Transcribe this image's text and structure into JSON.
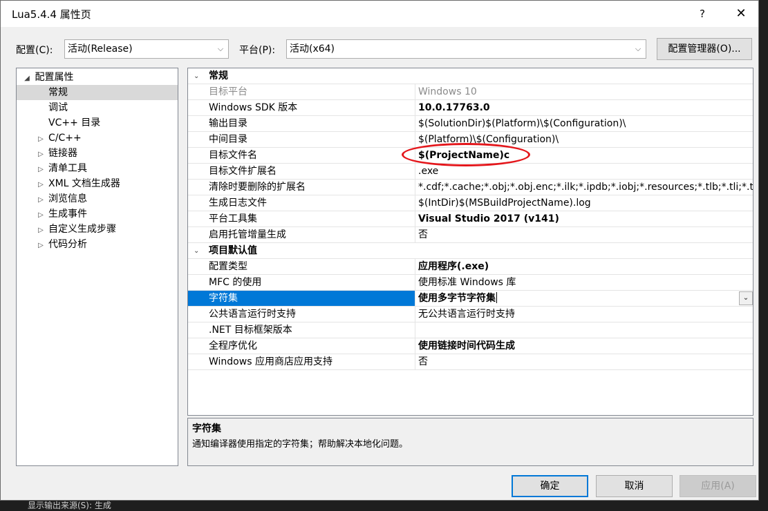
{
  "window": {
    "title": "Lua5.4.4 属性页",
    "help_label": "?",
    "close_label": "✕"
  },
  "toolbar": {
    "config_label": "配置(C):",
    "config_value": "活动(Release)",
    "platform_label": "平台(P):",
    "platform_value": "活动(x64)",
    "config_manager_label": "配置管理器(O)..."
  },
  "tree": {
    "root": "配置属性",
    "items": [
      {
        "label": "常规",
        "expandable": false,
        "selected": true
      },
      {
        "label": "调试",
        "expandable": false
      },
      {
        "label": "VC++ 目录",
        "expandable": false
      },
      {
        "label": "C/C++",
        "expandable": true
      },
      {
        "label": "链接器",
        "expandable": true
      },
      {
        "label": "清单工具",
        "expandable": true
      },
      {
        "label": "XML 文档生成器",
        "expandable": true
      },
      {
        "label": "浏览信息",
        "expandable": true
      },
      {
        "label": "生成事件",
        "expandable": true
      },
      {
        "label": "自定义生成步骤",
        "expandable": true
      },
      {
        "label": "代码分析",
        "expandable": true
      }
    ]
  },
  "grid": {
    "sections": [
      {
        "title": "常规",
        "rows": [
          {
            "name": "目标平台",
            "value": "Windows 10",
            "gray": true
          },
          {
            "name": "Windows SDK 版本",
            "value": "10.0.17763.0",
            "bold": true
          },
          {
            "name": "输出目录",
            "value": "$(SolutionDir)$(Platform)\\$(Configuration)\\"
          },
          {
            "name": "中间目录",
            "value": "$(Platform)\\$(Configuration)\\"
          },
          {
            "name": "目标文件名",
            "value": "$(ProjectName)c",
            "bold": true
          },
          {
            "name": "目标文件扩展名",
            "value": ".exe"
          },
          {
            "name": "清除时要删除的扩展名",
            "value": "*.cdf;*.cache;*.obj;*.obj.enc;*.ilk;*.ipdb;*.iobj;*.resources;*.tlb;*.tli;*.t"
          },
          {
            "name": "生成日志文件",
            "value": "$(IntDir)$(MSBuildProjectName).log"
          },
          {
            "name": "平台工具集",
            "value": "Visual Studio 2017 (v141)",
            "bold": true
          },
          {
            "name": "启用托管增量生成",
            "value": "否"
          }
        ]
      },
      {
        "title": "项目默认值",
        "rows": [
          {
            "name": "配置类型",
            "value": "应用程序(.exe)",
            "bold": true
          },
          {
            "name": "MFC 的使用",
            "value": "使用标准 Windows 库"
          },
          {
            "name": "字符集",
            "value": "使用多字节字符集",
            "bold": true,
            "selected": true
          },
          {
            "name": "公共语言运行时支持",
            "value": "无公共语言运行时支持"
          },
          {
            "name": ".NET 目标框架版本",
            "value": ""
          },
          {
            "name": "全程序优化",
            "value": "使用链接时间代码生成",
            "bold": true
          },
          {
            "name": "Windows 应用商店应用支持",
            "value": "否"
          }
        ]
      }
    ]
  },
  "description": {
    "title": "字符集",
    "text": "通知编译器使用指定的字符集；帮助解决本地化问题。"
  },
  "buttons": {
    "ok": "确定",
    "cancel": "取消",
    "apply": "应用(A)"
  },
  "background": {
    "status_text": "显示输出来源(S): 生成"
  },
  "annotation": {
    "color": "#e4161b"
  }
}
